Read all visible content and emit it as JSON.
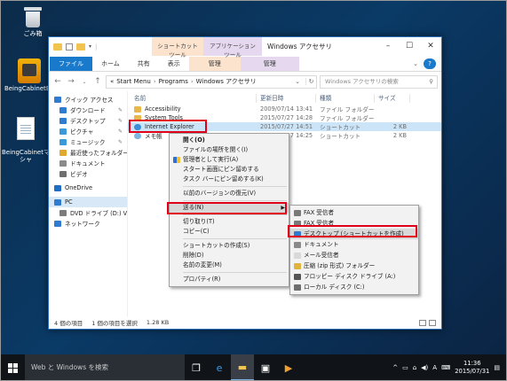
{
  "desktop": {
    "icons": [
      {
        "label": "ごみ箱",
        "icon": "recycle-bin-icon"
      },
      {
        "label": "BeingCabinetBe",
        "icon": "beingcabinet-app-icon"
      },
      {
        "label": "BeingCabinetマ\nシャ",
        "icon": "document-icon"
      }
    ]
  },
  "window": {
    "title": "Windows アクセサリ",
    "context_tab_shortcut": "ショートカット ツール",
    "context_tab_app": "アプリケーション ツール",
    "ribbon_tabs": [
      "ファイル",
      "ホーム",
      "共有",
      "表示",
      "管理",
      "管理"
    ],
    "breadcrumb": [
      "«",
      "Start Menu",
      "Programs",
      "Windows アクセサリ"
    ],
    "search_placeholder": "Windows アクセサリの検索",
    "columns": [
      "名前",
      "更新日時",
      "種類",
      "サイズ"
    ],
    "nav_items": [
      {
        "label": "クイック アクセス",
        "icon": "star-icon",
        "color": "#2f7bd0"
      },
      {
        "label": "ダウンロード",
        "icon": "download-icon",
        "color": "#2f7bd0",
        "pinned": true
      },
      {
        "label": "デスクトップ",
        "icon": "desktop-icon",
        "color": "#2f7bd0",
        "pinned": true
      },
      {
        "label": "ピクチャ",
        "icon": "pictures-icon",
        "color": "#3a9ad9",
        "pinned": true
      },
      {
        "label": "ミュージック",
        "icon": "music-icon",
        "color": "#3a9ad9",
        "pinned": true
      },
      {
        "label": "最近使ったフォルダー",
        "icon": "recent-icon",
        "color": "#e0a82e",
        "pinned": true
      },
      {
        "label": "ドキュメント",
        "icon": "documents-icon",
        "color": "#8a8a8a"
      },
      {
        "label": "ビデオ",
        "icon": "videos-icon",
        "color": "#6f6f6f"
      },
      {
        "label": "OneDrive",
        "icon": "onedrive-icon",
        "color": "#1e6fc4"
      },
      {
        "label": "PC",
        "icon": "pc-icon",
        "color": "#2f7bd0",
        "selected": true
      },
      {
        "label": "DVD ドライブ (D:) VMw",
        "icon": "dvd-drive-icon",
        "color": "#7b7b7b"
      },
      {
        "label": "ネットワーク",
        "icon": "network-icon",
        "color": "#2f7bd0"
      }
    ],
    "files": [
      {
        "name": "Accessibility",
        "date": "2009/07/14 13:41",
        "type": "ファイル フォルダー",
        "size": "",
        "icon": "folder-icon",
        "selected": false
      },
      {
        "name": "System Tools",
        "date": "2015/07/27 14:28",
        "type": "ファイル フォルダー",
        "size": "",
        "icon": "folder-icon",
        "selected": false
      },
      {
        "name": "Internet Explorer",
        "date": "2015/07/27 14:51",
        "type": "ショートカット",
        "size": "2 KB",
        "icon": "internet-explorer-icon",
        "selected": true
      },
      {
        "name": "メモ帳",
        "date": "2015/07/27 14:25",
        "type": "ショートカット",
        "size": "2 KB",
        "icon": "notepad-icon",
        "selected": false
      }
    ],
    "status": {
      "count": "4 個の項目",
      "selection": "1 個の項目を選択",
      "size": "1.28 KB"
    }
  },
  "context_menu": {
    "items": [
      {
        "label": "開く(O)",
        "bold": true
      },
      {
        "label": "ファイルの場所を開く(I)"
      },
      {
        "label": "管理者として実行(A)",
        "icon": "shield-icon"
      },
      {
        "label": "スタート画面にピン留めする"
      },
      {
        "label": "タスク バーにピン留めする(K)"
      },
      {
        "separator": true
      },
      {
        "label": "以前のバージョンの復元(V)"
      },
      {
        "separator": true
      },
      {
        "label": "送る(N)",
        "submenu": true,
        "highlighted": true
      },
      {
        "separator": true
      },
      {
        "label": "切り取り(T)"
      },
      {
        "label": "コピー(C)"
      },
      {
        "separator": true
      },
      {
        "label": "ショートカットの作成(S)"
      },
      {
        "label": "削除(D)"
      },
      {
        "label": "名前の変更(M)"
      },
      {
        "separator": true
      },
      {
        "label": "プロパティ(R)"
      }
    ]
  },
  "send_to_menu": {
    "items": [
      {
        "label": "FAX 受信者",
        "icon": "fax-icon",
        "color": "#7a7a7a"
      },
      {
        "label": "FAX 受信者",
        "icon": "fax-icon",
        "color": "#7a7a7a"
      },
      {
        "label": "デスクトップ (ショートカットを作成)",
        "icon": "desktop-icon",
        "color": "#2f7bd0",
        "highlighted": true
      },
      {
        "label": "ドキュメント",
        "icon": "documents-icon",
        "color": "#8a8a8a"
      },
      {
        "label": "メール受信者",
        "icon": "mail-icon",
        "color": "#d9d9d9"
      },
      {
        "label": "圧縮 (zip 形式) フォルダー",
        "icon": "zip-folder-icon",
        "color": "#e0b33c"
      },
      {
        "label": "フロッピー ディスク ドライブ (A:)",
        "icon": "floppy-icon",
        "color": "#555555"
      },
      {
        "label": "ローカル ディスク (C:)",
        "icon": "local-disk-icon",
        "color": "#6f6f6f"
      }
    ]
  },
  "taskbar": {
    "search_placeholder": "Web と Windows を検索",
    "apps": [
      {
        "icon": "task-view-icon",
        "glyph": "❐"
      },
      {
        "icon": "edge-icon",
        "glyph": "e"
      },
      {
        "icon": "file-explorer-icon",
        "glyph": "▬"
      },
      {
        "icon": "store-icon",
        "glyph": "▣"
      },
      {
        "icon": "media-icon",
        "glyph": "▶"
      }
    ],
    "tray_chevron": "^",
    "ime": "A",
    "time": "11:36",
    "date": "2015/07/31"
  },
  "colors": {
    "accent": "#1979ca",
    "highlight_box": "#e1001a",
    "selection": "#cce4f7"
  }
}
